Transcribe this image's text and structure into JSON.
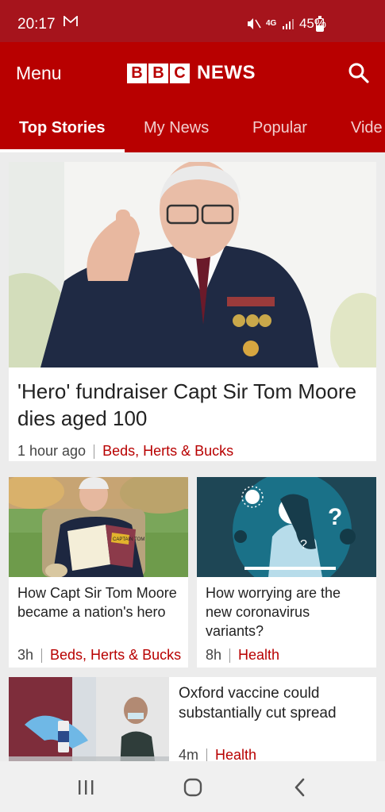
{
  "status_bar": {
    "time": "20:17",
    "network": "4G",
    "battery_percent": "45%",
    "battery_level": 0.45
  },
  "header": {
    "menu_label": "Menu",
    "brand_letters": [
      "B",
      "B",
      "C"
    ],
    "brand_word": "NEWS"
  },
  "tabs": [
    {
      "label": "Top Stories",
      "active": true
    },
    {
      "label": "My News",
      "active": false
    },
    {
      "label": "Popular",
      "active": false
    },
    {
      "label": "Vide",
      "active": false
    }
  ],
  "stories": [
    {
      "headline": "'Hero' fundraiser Capt Sir Tom Moore dies aged 100",
      "time": "1 hour ago",
      "topic": "Beds, Herts & Bucks"
    },
    {
      "headline": "How Capt Sir Tom Moore became a nation's hero",
      "time": "3h",
      "topic": "Beds, Herts & Bucks",
      "book_title": "CAPTAIN TOM"
    },
    {
      "headline": "How worrying are the new coronavirus variants?",
      "time": "8h",
      "topic": "Health"
    },
    {
      "headline": "Oxford vaccine could substantially cut spread",
      "time": "4m",
      "topic": "Health"
    }
  ],
  "colors": {
    "brand_red": "#b80000",
    "status_red": "#a6141c",
    "topic_red": "#b80000"
  }
}
